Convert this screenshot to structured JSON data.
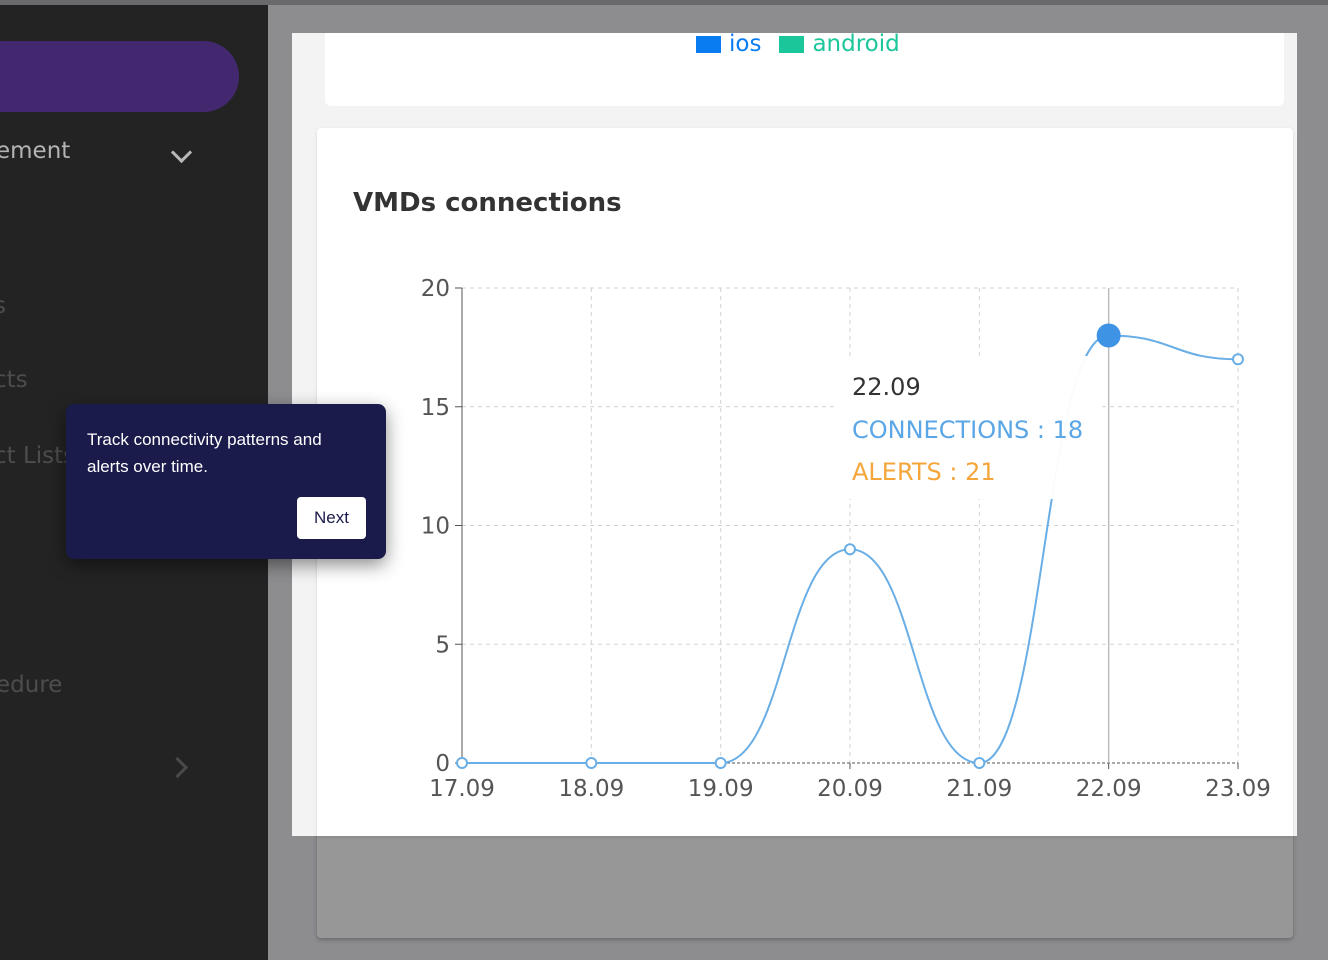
{
  "sidebar": {
    "items": [
      {
        "label": "ement"
      },
      {
        "label": "s"
      },
      {
        "label": "cts"
      },
      {
        "label": "ct Lists"
      },
      {
        "label": "edure"
      }
    ]
  },
  "legend": {
    "items": [
      {
        "label": "ios",
        "color": "#0a7cf2"
      },
      {
        "label": "android",
        "color": "#1bc79a"
      }
    ]
  },
  "card": {
    "title": "VMDs connections"
  },
  "chart_data": {
    "type": "line",
    "title": "VMDs connections",
    "x": [
      "17.09",
      "18.09",
      "19.09",
      "20.09",
      "21.09",
      "22.09",
      "23.09"
    ],
    "ylim": [
      0,
      20
    ],
    "yticks": [
      0,
      5,
      10,
      15,
      20
    ],
    "grid": true,
    "series": [
      {
        "name": "CONNECTIONS",
        "values": [
          0,
          0,
          0,
          9,
          0,
          18,
          17
        ],
        "color": "#6aaee6"
      }
    ],
    "highlight_index": 5,
    "hover_tooltip": {
      "date": "22.09",
      "lines": [
        {
          "text": "CONNECTIONS : 18",
          "color": "#5aa6e6"
        },
        {
          "text": "ALERTS : 21",
          "color": "#f4a63a"
        }
      ]
    }
  },
  "onboarding": {
    "text": "Track connectivity patterns and alerts over time.",
    "next_label": "Next"
  }
}
